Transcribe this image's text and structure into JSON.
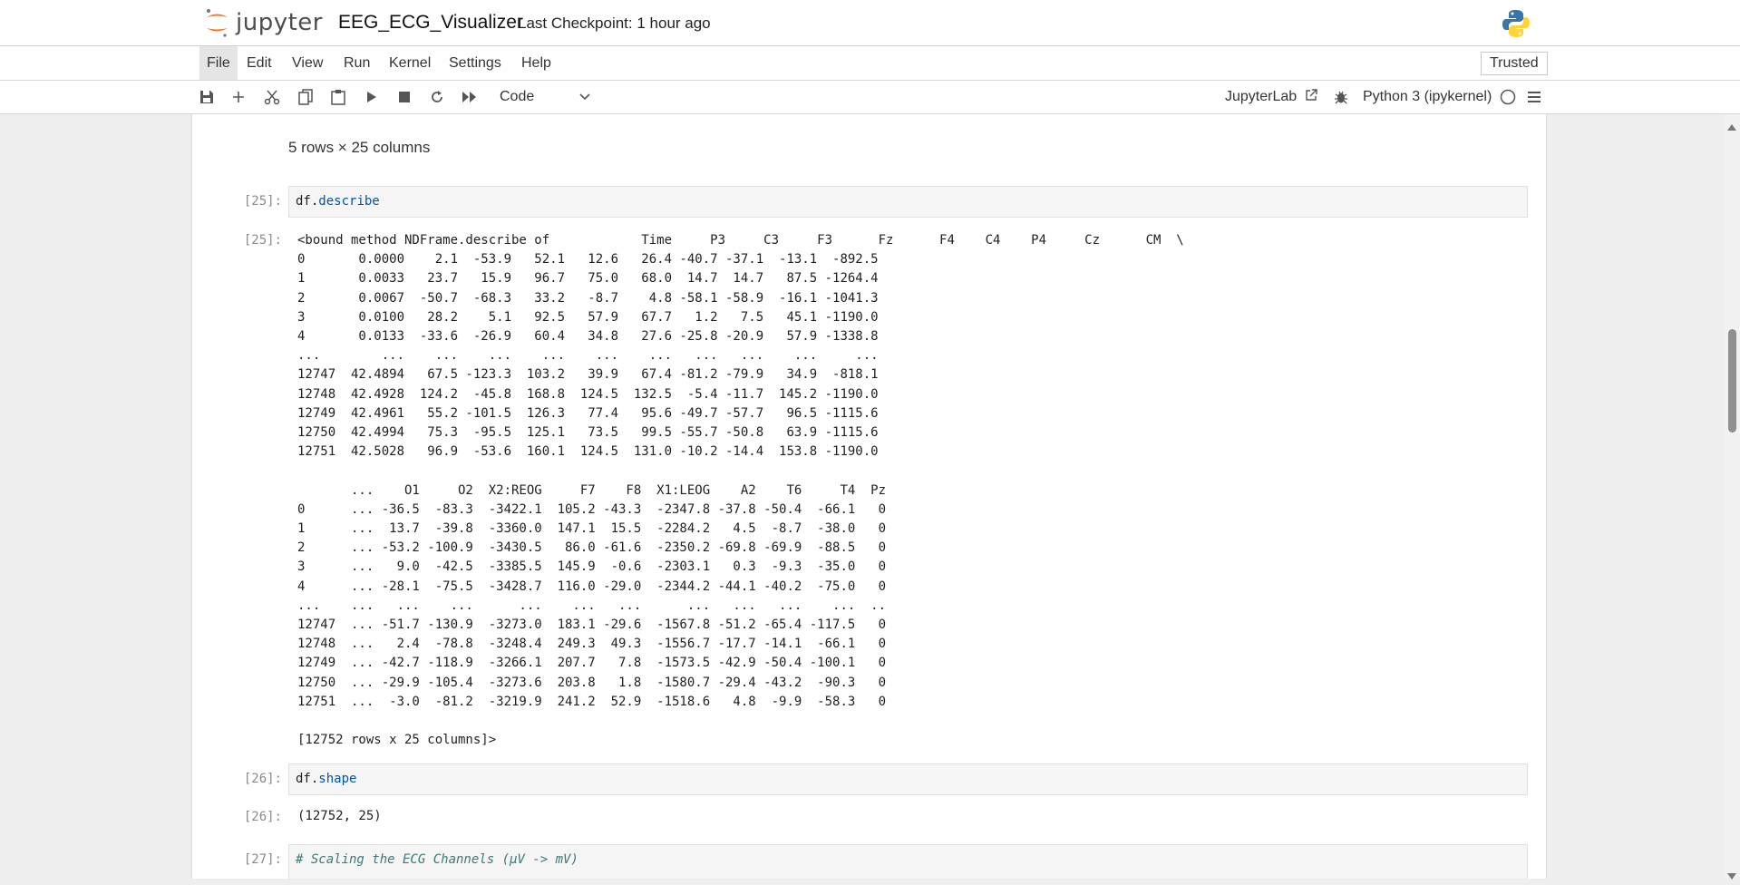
{
  "header": {
    "logo_text": "jupyter",
    "notebook_title": "EEG_ECG_Visualizer",
    "checkpoint": "Last Checkpoint: 1 hour ago"
  },
  "menu": {
    "items": [
      "File",
      "Edit",
      "View",
      "Run",
      "Kernel",
      "Settings",
      "Help"
    ],
    "trusted": "Trusted"
  },
  "toolbar": {
    "cell_type": "Code",
    "jupyterlab_label": "JupyterLab",
    "kernel": "Python 3 (ipykernel)"
  },
  "cells": {
    "prev_output": "5 rows × 25 columns",
    "c25": {
      "prompt_in": "[25]:",
      "code_var": "df.",
      "code_attr": "describe",
      "prompt_out": "[25]:",
      "output": "<bound method NDFrame.describe of            Time     P3     C3     F3      Fz      F4    C4    P4     Cz      CM  \\\n0       0.0000    2.1  -53.9   52.1   12.6   26.4 -40.7 -37.1  -13.1  -892.5\n1       0.0033   23.7   15.9   96.7   75.0   68.0  14.7  14.7   87.5 -1264.4\n2       0.0067  -50.7  -68.3   33.2   -8.7    4.8 -58.1 -58.9  -16.1 -1041.3\n3       0.0100   28.2    5.1   92.5   57.9   67.7   1.2   7.5   45.1 -1190.0\n4       0.0133  -33.6  -26.9   60.4   34.8   27.6 -25.8 -20.9   57.9 -1338.8\n...        ...    ...    ...    ...    ...    ...   ...   ...    ...     ...\n12747  42.4894   67.5 -123.3  103.2   39.9   67.4 -81.2 -79.9   34.9  -818.1\n12748  42.4928  124.2  -45.8  168.8  124.5  132.5  -5.4 -11.7  145.2 -1190.0\n12749  42.4961   55.2 -101.5  126.3   77.4   95.6 -49.7 -57.7   96.5 -1115.6\n12750  42.4994   75.3  -95.5  125.1   73.5   99.5 -55.7 -50.8   63.9 -1115.6\n12751  42.5028   96.9  -53.6  160.1  124.5  131.0 -10.2 -14.4  153.8 -1190.0\n\n       ...    O1     O2  X2:REOG     F7    F8  X1:LEOG    A2    T6     T4  Pz\n0      ... -36.5  -83.3  -3422.1  105.2 -43.3  -2347.8 -37.8 -50.4  -66.1   0\n1      ...  13.7  -39.8  -3360.0  147.1  15.5  -2284.2   4.5  -8.7  -38.0   0\n2      ... -53.2 -100.9  -3430.5   86.0 -61.6  -2350.2 -69.8 -69.9  -88.5   0\n3      ...   9.0  -42.5  -3385.5  145.9  -0.6  -2303.1   0.3  -9.3  -35.0   0\n4      ... -28.1  -75.5  -3428.7  116.0 -29.0  -2344.2 -44.1 -40.2  -75.0   0\n...    ...   ...    ...      ...    ...   ...      ...   ...   ...    ...  ..\n12747  ... -51.7 -130.9  -3273.0  183.1 -29.6  -1567.8 -51.2 -65.4 -117.5   0\n12748  ...   2.4  -78.8  -3248.4  249.3  49.3  -1556.7 -17.7 -14.1  -66.1   0\n12749  ... -42.7 -118.9  -3266.1  207.7   7.8  -1573.5 -42.9 -50.4 -100.1   0\n12750  ... -29.9 -105.4  -3273.6  203.8   1.8  -1580.7 -29.4 -43.2  -90.3   0\n12751  ...  -3.0  -81.2  -3219.9  241.2  52.9  -1518.6   4.8  -9.9  -58.3   0\n\n[12752 rows x 25 columns]>"
    },
    "c26": {
      "prompt_in": "[26]:",
      "code_var": "df.",
      "code_attr": "shape",
      "prompt_out": "[26]:",
      "output": "(12752, 25)"
    },
    "c27": {
      "prompt_in": "[27]:",
      "comment": "# Scaling the ECG Channels (μV -> mV)"
    }
  }
}
